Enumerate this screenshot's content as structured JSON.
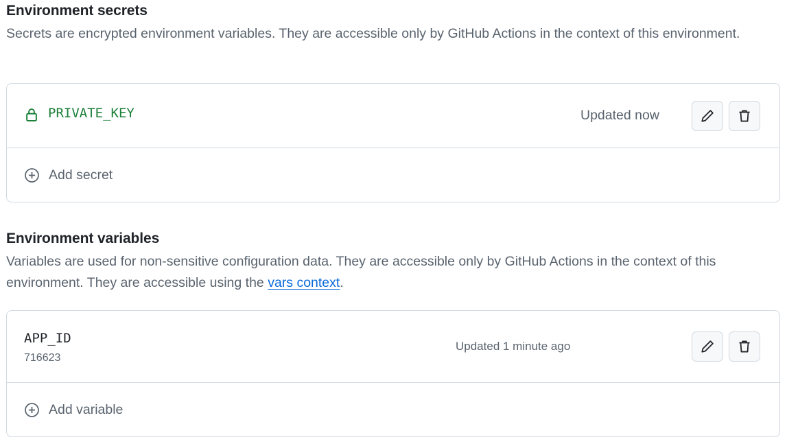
{
  "secrets": {
    "title": "Environment secrets",
    "description": "Secrets are encrypted environment variables. They are accessible only by GitHub Actions in the context of this environment.",
    "items": [
      {
        "name": "PRIVATE_KEY",
        "updated": "Updated now",
        "icon": "lock-icon"
      }
    ],
    "add_label": "Add secret"
  },
  "variables": {
    "title": "Environment variables",
    "description_prefix": "Variables are used for non-sensitive configuration data. They are accessible only by GitHub Actions in the context of this environment. They are accessible using the ",
    "description_link": "vars context",
    "description_suffix": ".",
    "items": [
      {
        "name": "APP_ID",
        "value": "716623",
        "updated": "Updated 1 minute ago"
      }
    ],
    "add_label": "Add variable"
  },
  "icons": {
    "edit": "pencil-icon",
    "delete": "trash-icon",
    "add": "plus-circle-icon"
  },
  "colors": {
    "secret_name": "#1a7f37",
    "link": "#0969da",
    "muted_text": "#59636e",
    "border": "#d1d9e0",
    "button_bg": "#f6f8fa"
  }
}
